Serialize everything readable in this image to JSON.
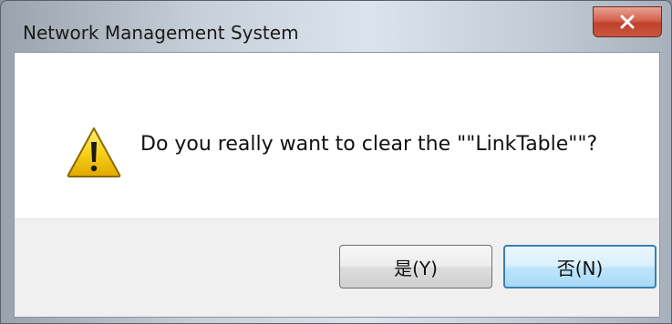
{
  "window": {
    "title": "Network Management System"
  },
  "dialog": {
    "icon": "warning-icon",
    "message": "Do you really want to clear the \"\"LinkTable\"\"?",
    "buttons": {
      "yes_label": "是(Y)",
      "no_label": "否(N)"
    }
  },
  "colors": {
    "close_button": "#c9563f",
    "warning_yellow": "#f5c400",
    "default_button_border": "#3c7fb1"
  }
}
